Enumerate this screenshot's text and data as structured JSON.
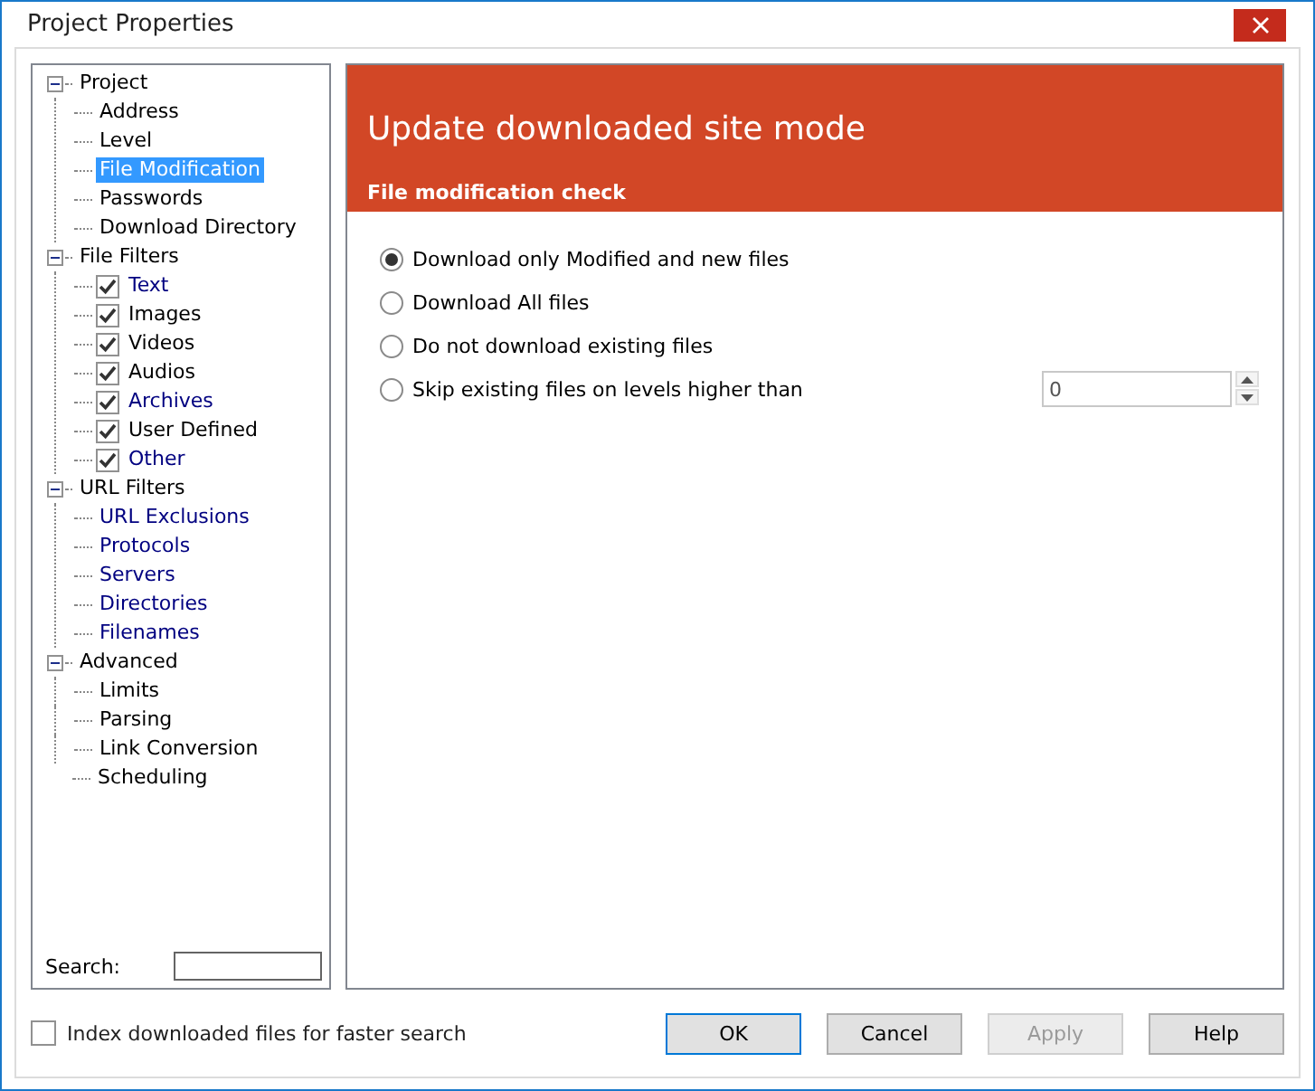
{
  "window": {
    "title": "Project Properties"
  },
  "tree": [
    {
      "label": "Project",
      "expanded": true,
      "children": [
        {
          "label": "Address",
          "selected": false
        },
        {
          "label": "Level",
          "selected": false
        },
        {
          "label": "File Modification",
          "selected": true
        },
        {
          "label": "Passwords",
          "selected": false
        },
        {
          "label": "Download Directory",
          "selected": false
        }
      ]
    },
    {
      "label": "File Filters",
      "expanded": true,
      "children": [
        {
          "label": "Text",
          "selected": false,
          "checked": true,
          "color": "#000080"
        },
        {
          "label": "Images",
          "selected": false,
          "checked": true
        },
        {
          "label": "Videos",
          "selected": false,
          "checked": true
        },
        {
          "label": "Audios",
          "selected": false,
          "checked": true
        },
        {
          "label": "Archives",
          "selected": false,
          "checked": true,
          "color": "#000080"
        },
        {
          "label": "User Defined",
          "selected": false,
          "checked": true
        },
        {
          "label": "Other",
          "selected": false,
          "checked": true,
          "color": "#000080"
        }
      ]
    },
    {
      "label": "URL Filters",
      "expanded": true,
      "children": [
        {
          "label": "URL Exclusions",
          "selected": false,
          "color": "#000080"
        },
        {
          "label": "Protocols",
          "selected": false,
          "color": "#000080"
        },
        {
          "label": "Servers",
          "selected": false,
          "color": "#000080"
        },
        {
          "label": "Directories",
          "selected": false,
          "color": "#000080"
        },
        {
          "label": "Filenames",
          "selected": false,
          "color": "#000080"
        }
      ]
    },
    {
      "label": "Advanced",
      "expanded": true,
      "children": [
        {
          "label": "Limits",
          "selected": false
        },
        {
          "label": "Parsing",
          "selected": false
        },
        {
          "label": "Link Conversion",
          "selected": false
        },
        {
          "label": "Scheduling",
          "selected": false
        }
      ]
    }
  ],
  "search": {
    "label": "Search:"
  },
  "panel": {
    "heading": "Update downloaded site mode",
    "subheading": "File modification check",
    "options": [
      {
        "label": "Download only Modified and new files",
        "selected": true
      },
      {
        "label": "Download All files",
        "selected": false
      },
      {
        "label": "Do not download existing files",
        "selected": false
      },
      {
        "label": "Skip existing files on levels higher than",
        "selected": false,
        "spin_value": "0"
      }
    ]
  },
  "index_option": {
    "label": "Index downloaded files for faster search",
    "checked": false
  },
  "buttons": [
    {
      "label": "OK",
      "disabled": false,
      "default": true
    },
    {
      "label": "Cancel",
      "disabled": false,
      "default": false
    },
    {
      "label": "Apply",
      "disabled": true,
      "default": false
    },
    {
      "label": "Help",
      "disabled": false,
      "default": false
    }
  ]
}
